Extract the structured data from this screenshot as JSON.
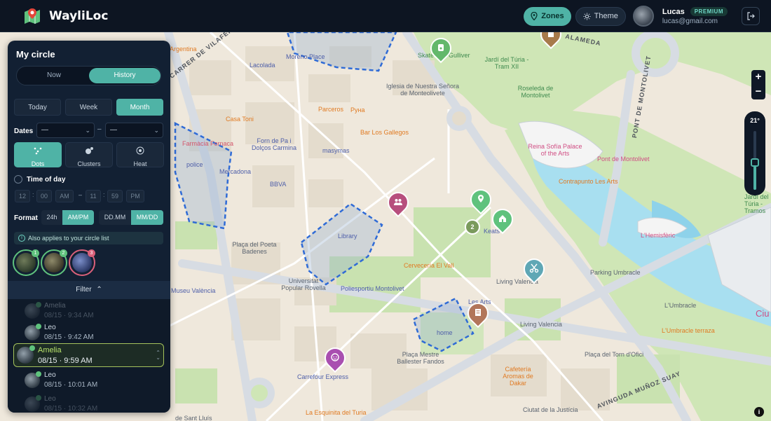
{
  "app": {
    "brand": "WayliLoc"
  },
  "header": {
    "zones_label": "Zones",
    "theme_label": "Theme",
    "user_name": "Lucas",
    "plan_badge": "PREMIUM",
    "user_email": "lucas@gmail.com",
    "accent_color": "#4fb3a6"
  },
  "panel": {
    "title": "My circle",
    "modes": [
      "Now",
      "History"
    ],
    "active_mode": "History",
    "ranges": [
      "Today",
      "Week",
      "Month"
    ],
    "active_range": "Month",
    "dates_label": "Dates",
    "date_from": "—",
    "date_to": "—",
    "date_sep": "–",
    "viz": [
      "Dots",
      "Clusters",
      "Heat"
    ],
    "active_viz": "Dots",
    "time_of_day_label": "Time of day",
    "time_from": {
      "h": "12",
      "m": "00",
      "ampm": "AM"
    },
    "time_to": {
      "h": "11",
      "m": "59",
      "ampm": "PM"
    },
    "time_range_sep": "–",
    "format_label": "Format",
    "time_formats": [
      "24h",
      "AM/PM"
    ],
    "active_time_format": "AM/PM",
    "date_formats": [
      "DD.MM",
      "MM/DD"
    ],
    "active_date_format": "MM/DD",
    "note": "Also applies to your circle list",
    "members": [
      {
        "badge": "1"
      },
      {
        "badge": "2"
      },
      {
        "badge": "3"
      }
    ],
    "filter_label": "Filter",
    "history": [
      {
        "name": "Amelia",
        "time": "08/15 · 9:34 AM",
        "faded": true
      },
      {
        "name": "Leo",
        "time": "08/15 · 9:42 AM"
      },
      {
        "name": "Amelia",
        "time": "08/15 · 9:59 AM",
        "selected": true
      },
      {
        "name": "Leo",
        "time": "08/15 · 10:01 AM"
      },
      {
        "name": "Leo",
        "time": "08/15 · 10:32 AM",
        "faded": true
      }
    ]
  },
  "map": {
    "tilt": "21°",
    "zoom_in": "+",
    "zoom_out": "−",
    "info": "i",
    "labels": {
      "argentina": "Argentina",
      "moreno_place": "Moreno Place",
      "lacolada": "Lacolada",
      "skate": "Skate",
      "gulliver": "Gulliver",
      "jardi_turia": "Jardí del Túria - Tram XII",
      "alameda": "ALAMEDA",
      "iglesia": "Iglesia de Nuestra Señora de Monteolivete",
      "roseleda": "Roseleda de Montolivet",
      "parceros": "Parceros",
      "pyna": "Руна",
      "casa_toni": "Casa Toni",
      "bar_gallegos": "Bar Los Gallegos",
      "carrer_vilafermosa": "CARRER DE VILAFERMOSA",
      "pont_montolivet": "PONT DE MONTOLIVET",
      "farmacia": "Farmàcia Fornaca",
      "forn_pa": "Forn de Pa i Dolços Carmina",
      "masymas": "masymas",
      "reina_sofia": "Reina Sofía Palace of the Arts",
      "pont_montolivet_2": "Pont de Montolivet",
      "police": "police",
      "mercadona": "Mercadona",
      "bbva": "BBVA",
      "contrapunto": "Contrapunto Les Arts",
      "jardi_tr": "Jardí del Túria - Tramos",
      "library": "Library",
      "placa_poeta": "Plaça del Poeta Badenes",
      "keats": "Keats",
      "hemisferic": "L'Hemisfèric",
      "cerveceria": "Cervecería El Vall",
      "parking": "Parking Umbracle",
      "universitat": "Universitat Popular Rovella",
      "poliesportiu": "Poliesportiu Montolivet",
      "living_valencia_1": "Living Valencia",
      "museu_valencia": "Museu València",
      "umbracle": "L'Umbracle",
      "umbracle_terraza": "L'Umbracle terraza",
      "cuidad": "Ciu",
      "home": "home",
      "living_valencia_2": "Living Valencia",
      "carrefour": "Carrefour Express",
      "placa_mestre": "Plaça Mestre Ballester Fandos",
      "placa_torn": "Plaça del Torn d'Ofici",
      "cafeteria": "Cafetería Aromas de Dakar",
      "avinguda": "AVINGUDA MUÑOZ SUAY",
      "ciutat_justicia": "Ciutat de la Justícia",
      "esquinita": "La Esquinita del Turia",
      "sant_lluis": "de Sant Lluís",
      "les_arts": "Les Arts",
      "cluster_count": "2"
    }
  }
}
